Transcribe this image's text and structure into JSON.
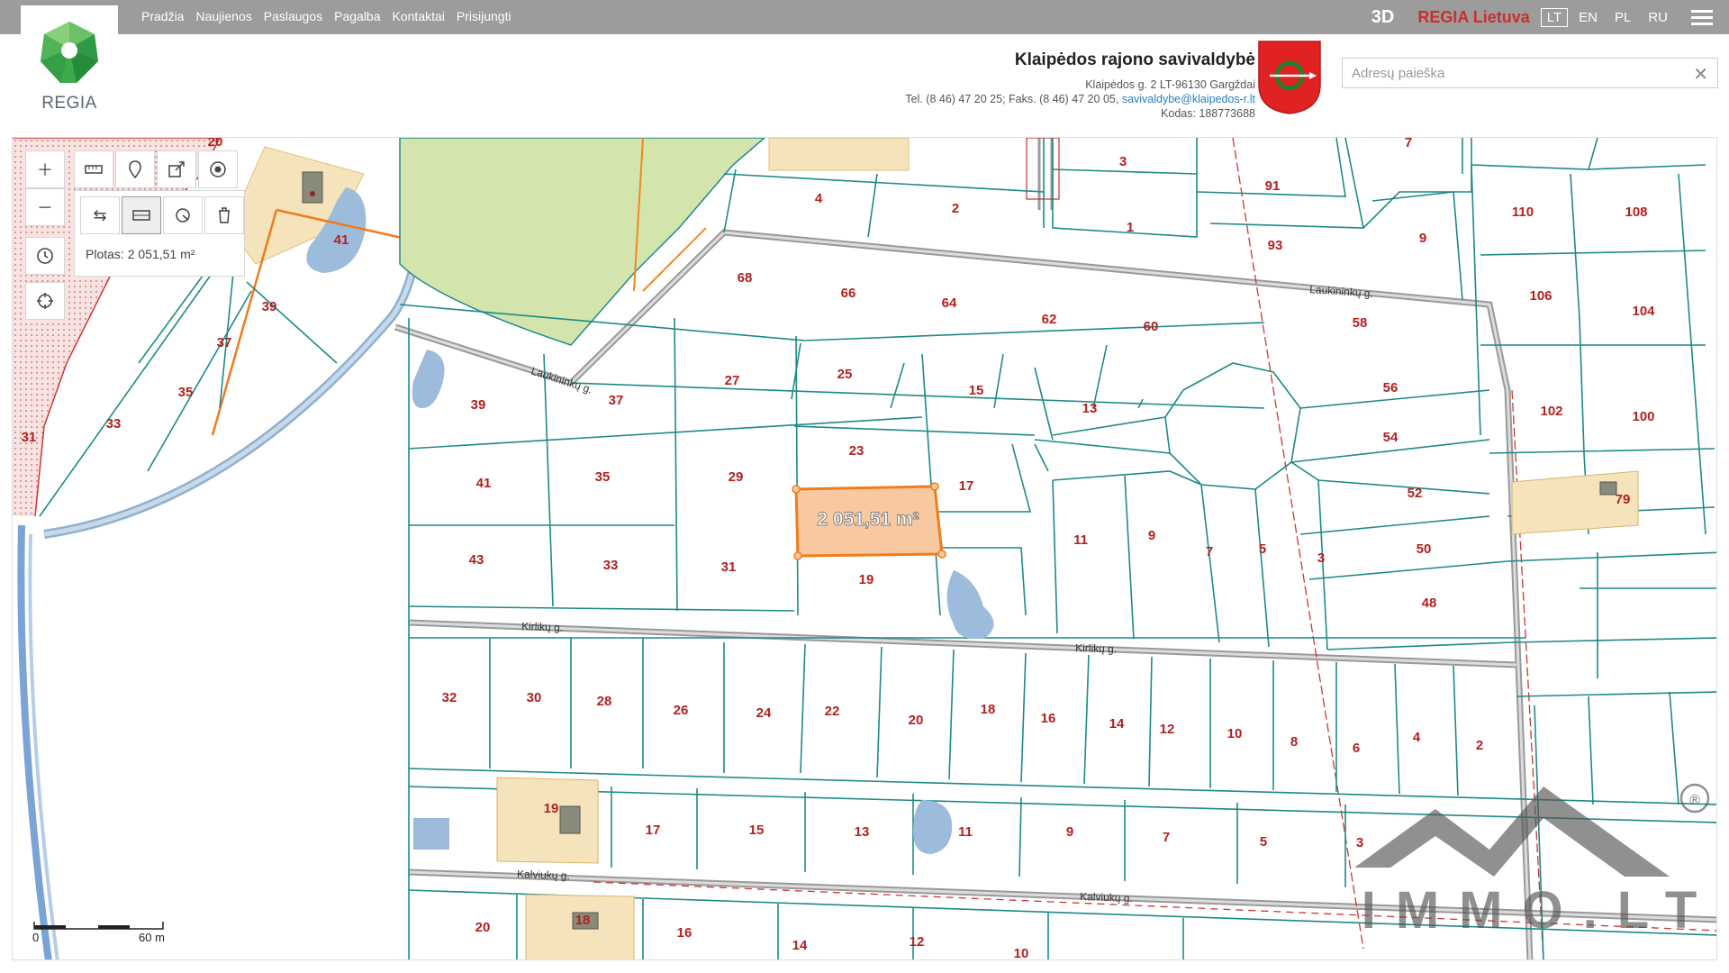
{
  "header": {
    "nav": [
      "Pradžia",
      "Naujienos",
      "Paslaugos",
      "Pagalba",
      "Kontaktai",
      "Prisijungti"
    ],
    "btn_3d": "3D",
    "brand": "REGIA Lietuva",
    "languages": [
      "LT",
      "EN",
      "PL",
      "RU"
    ],
    "active_language": "LT",
    "logo_text": "REGIA"
  },
  "municipality": {
    "name": "Klaipėdos rajono savivaldybė",
    "address": "Klaipėdos g. 2 LT-96130 Gargždai",
    "phone": "Tel. (8 46) 47 20 25; Faks. (8 46) 47 20 05,",
    "email": "savivaldybe@klaipedos-r.lt",
    "code": "Kodas: 188773688"
  },
  "search": {
    "placeholder": "Adresų paieška"
  },
  "map": {
    "measure_panel": {
      "area_text": "Plotas: 2 051,51 m²"
    },
    "selected_label": "2 051,51 m²",
    "scale": {
      "zero": "0",
      "distance": "60 m"
    },
    "streets": {
      "laukininku_upper": "Laukininkų g.",
      "laukininku_diag": "Laukininkų g.",
      "kirliku_left": "Kirlikų g.",
      "kirliku_right": "Kirlikų g.",
      "kalviuku_left": "Kalviukų g.",
      "kalviuku_right": "Kalviukų g."
    },
    "parcel_numbers": [
      "20",
      "41",
      "39",
      "37",
      "35",
      "33",
      "31",
      "4",
      "2",
      "3",
      "1",
      "7",
      "91",
      "93",
      "9",
      "110",
      "108",
      "106",
      "104",
      "102",
      "100",
      "68",
      "66",
      "64",
      "62",
      "60",
      "58",
      "56",
      "54",
      "52",
      "50",
      "48",
      "79",
      "39",
      "37",
      "27",
      "25",
      "15",
      "13",
      "41",
      "35",
      "29",
      "23",
      "17",
      "11",
      "9",
      "7",
      "5",
      "3",
      "43",
      "33",
      "31",
      "19",
      "32",
      "30",
      "28",
      "26",
      "24",
      "22",
      "20",
      "18",
      "16",
      "14",
      "12",
      "10",
      "8",
      "6",
      "4",
      "2",
      "19",
      "17",
      "15",
      "13",
      "11",
      "9",
      "7",
      "5",
      "3",
      "20",
      "18",
      "16",
      "14",
      "12",
      "10"
    ],
    "watermark": "IMMO.LT",
    "watermark_mark": "®",
    "colors": {
      "parcel_line": "#1e8a86",
      "label": "#b32020",
      "selected_fill": "#f8c9a0",
      "selected_stroke": "#ee7d1a",
      "park": "#d4e4ad",
      "pond": "#9dbbdb"
    }
  }
}
